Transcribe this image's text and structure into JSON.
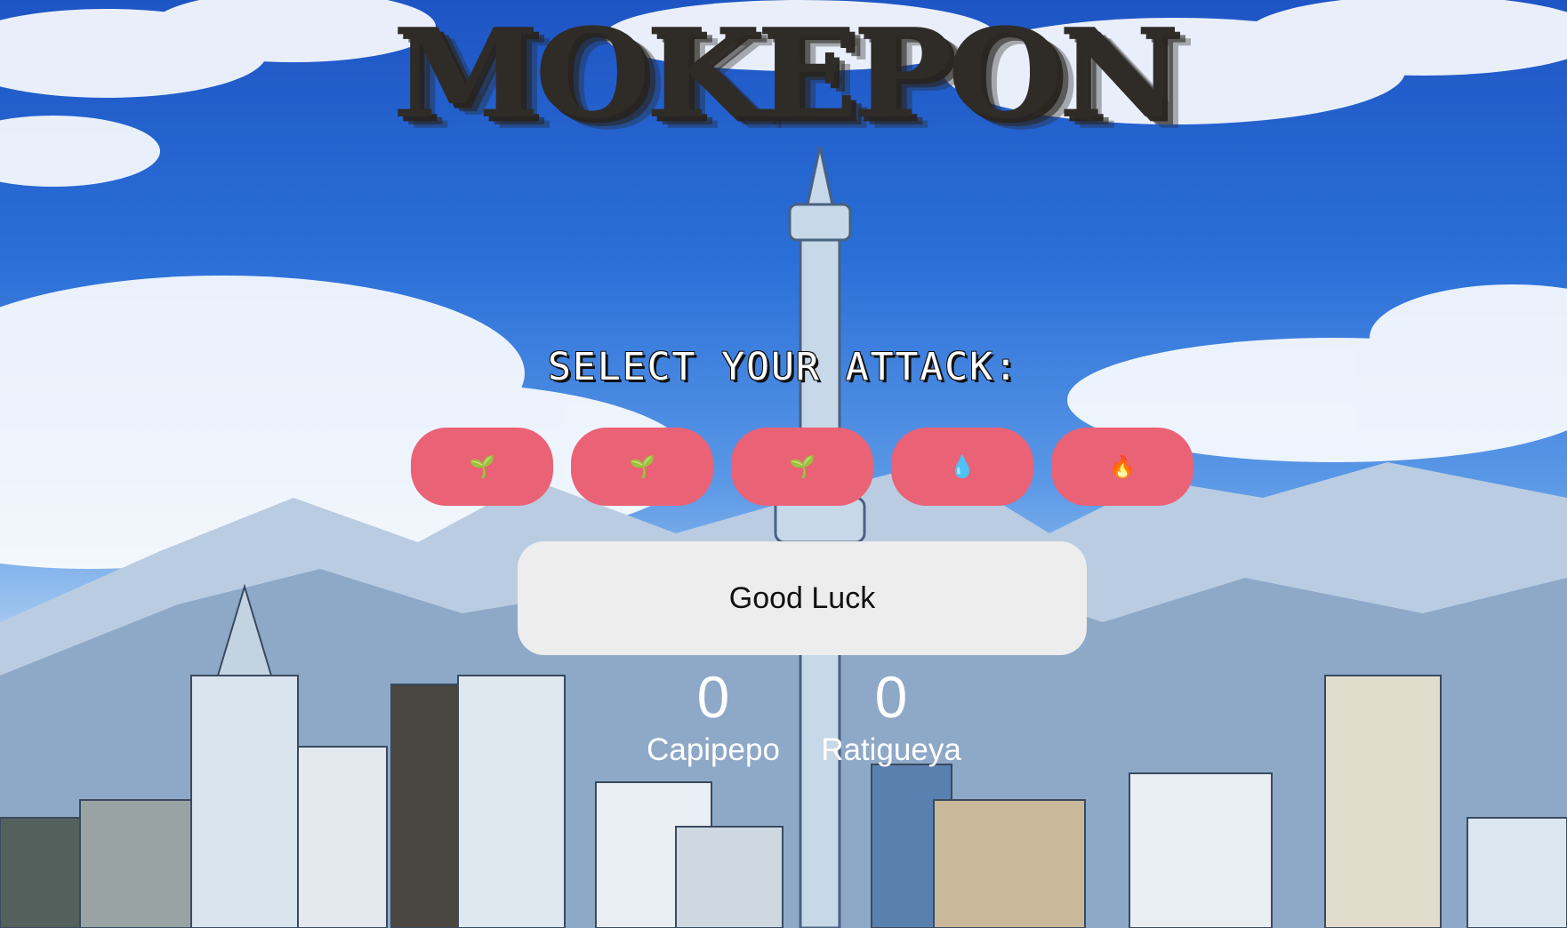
{
  "title": "MOKEPON",
  "heading": "SELECT YOUR ATTACK:",
  "attacks": [
    {
      "icon": "🌱",
      "icon_name": "sprout-icon",
      "type": "plant"
    },
    {
      "icon": "🌱",
      "icon_name": "sprout-icon",
      "type": "plant"
    },
    {
      "icon": "🌱",
      "icon_name": "sprout-icon",
      "type": "plant"
    },
    {
      "icon": "💧",
      "icon_name": "water-drop-icon",
      "type": "water"
    },
    {
      "icon": "🔥",
      "icon_name": "fire-icon",
      "type": "fire"
    }
  ],
  "message": "Good Luck",
  "score": {
    "player": {
      "value": "0",
      "name": "Capipepo"
    },
    "enemy": {
      "value": "0",
      "name": "Ratigueya"
    }
  },
  "colors": {
    "attack_button": "#ea6275",
    "message_box": "#ededed",
    "title": "#2f2b27"
  }
}
